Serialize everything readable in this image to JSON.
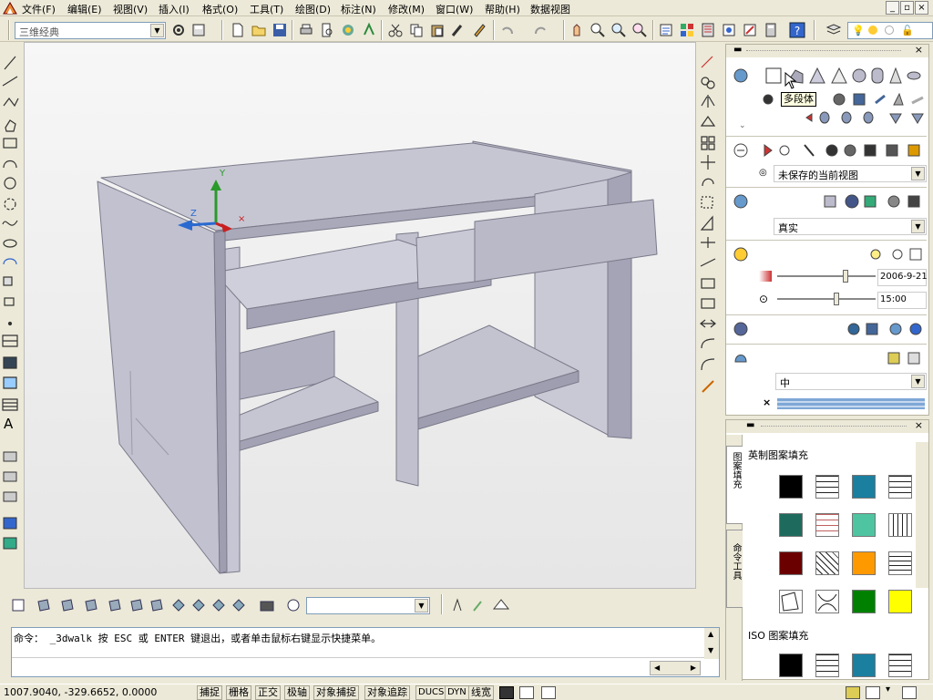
{
  "menu": [
    "文件(F)",
    "编辑(E)",
    "视图(V)",
    "插入(I)",
    "格式(O)",
    "工具(T)",
    "绘图(D)",
    "标注(N)",
    "修改(M)",
    "窗口(W)",
    "帮助(H)",
    "数据视图"
  ],
  "workspace_combo": "三维经典",
  "tooltip": "多段体",
  "dashboard": {
    "view_combo": "未保存的当前视图",
    "visual_style_combo": "真实",
    "date": "2006-9-21",
    "time": "15:00",
    "material_combo": "中"
  },
  "tool_palette": {
    "section1": "英制图案填充",
    "section2": "ISO 图案填充",
    "tabs": [
      "图案填充",
      "命令工具"
    ]
  },
  "command": {
    "line1": "命令：  _3dwalk 按 ESC 或 ENTER 键退出，或者单击鼠标右键显示快捷菜单。"
  },
  "status": {
    "coords": "1007.9040,   -329.6652, 0.0000",
    "buttons": [
      "捕捉",
      "栅格",
      "正交",
      "极轴",
      "对象捕捉",
      "对象追踪",
      "DUCS",
      "DYN",
      "线宽"
    ]
  },
  "colors": {
    "desk_face": "#c9c9d6",
    "desk_dark": "#9d9dae",
    "swatch_colors": [
      "#000000",
      "#1b7fa0",
      "#1e6b5e",
      "#4fc4a0",
      "#6b0000",
      "#ff9900",
      "#008000",
      "#ffff00"
    ]
  }
}
